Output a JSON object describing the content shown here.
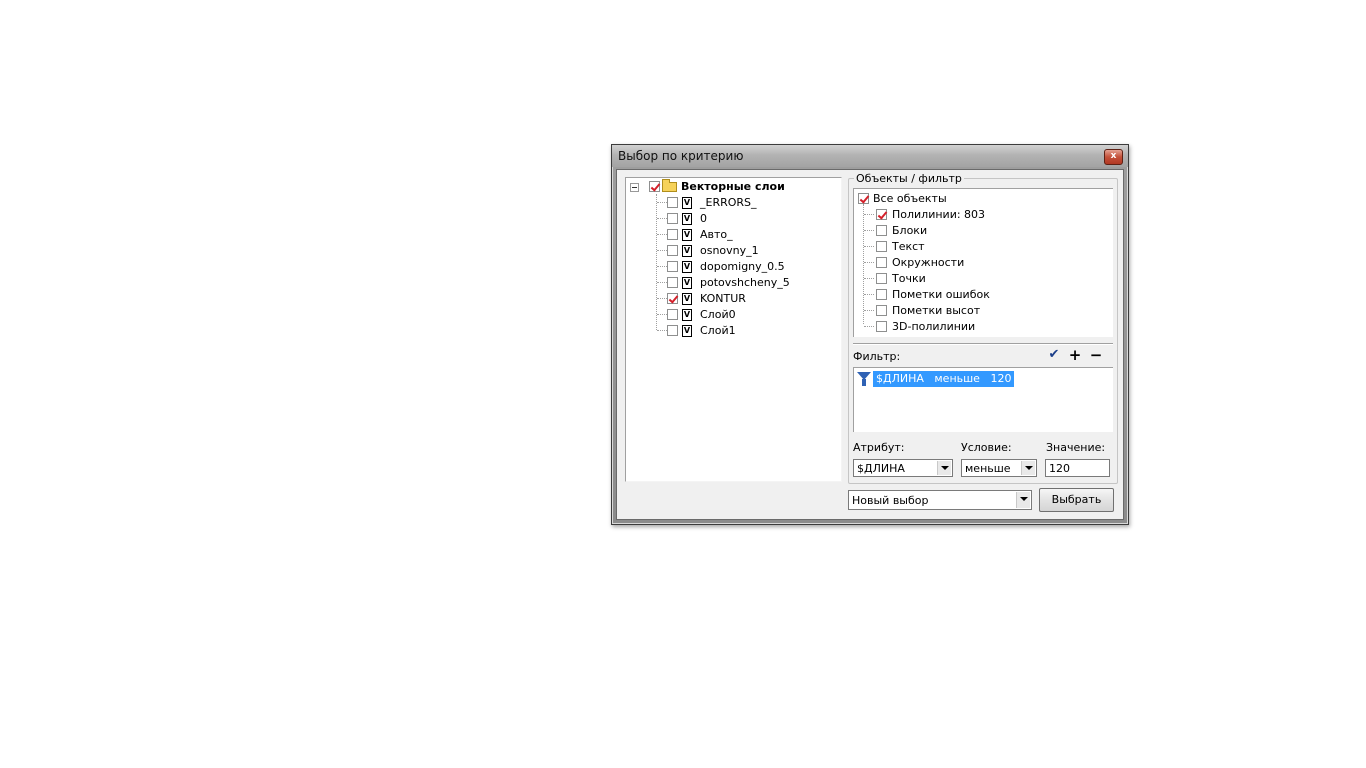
{
  "window": {
    "title": "Выбор по критерию",
    "close_glyph": "x"
  },
  "layers": {
    "root": {
      "label": "Векторные слои",
      "checked": true
    },
    "items": [
      {
        "label": "_ERRORS_",
        "checked": false
      },
      {
        "label": "0",
        "checked": false
      },
      {
        "label": "Авто_",
        "checked": false
      },
      {
        "label": "osnovny_1",
        "checked": false
      },
      {
        "label": "dopomigny_0.5",
        "checked": false
      },
      {
        "label": "potovshcheny_5",
        "checked": false
      },
      {
        "label": "KONTUR",
        "checked": true
      },
      {
        "label": "Слой0",
        "checked": false
      },
      {
        "label": "Слой1",
        "checked": false
      }
    ],
    "doc_icon_glyph": "V"
  },
  "objects_group": {
    "legend": "Объекты / фильтр",
    "root": {
      "label": "Все объекты",
      "checked": true
    },
    "items": [
      {
        "label": "Полилинии: 803",
        "checked": true
      },
      {
        "label": "Блоки",
        "checked": false
      },
      {
        "label": "Текст",
        "checked": false
      },
      {
        "label": "Окружности",
        "checked": false
      },
      {
        "label": "Точки",
        "checked": false
      },
      {
        "label": "Пометки ошибок",
        "checked": false
      },
      {
        "label": "Пометки высот",
        "checked": false
      },
      {
        "label": "3D-полилинии",
        "checked": false
      }
    ]
  },
  "filter": {
    "label": "Фильтр:",
    "apply_glyph": "✔",
    "add_glyph": "+",
    "remove_glyph": "−",
    "rows": [
      {
        "text": "$ДЛИНА   меньше   120"
      }
    ]
  },
  "condition": {
    "attribute_label": "Атрибут:",
    "attribute_value": "$ДЛИНА",
    "condition_label": "Условие:",
    "condition_value": "меньше",
    "value_label": "Значение:",
    "value_value": "120"
  },
  "footer": {
    "mode_value": "Новый выбор",
    "select_button": "Выбрать"
  },
  "colors": {
    "check_red": "#d4202a",
    "selection_blue": "#3399ff",
    "funnel_blue": "#2f62b4"
  }
}
